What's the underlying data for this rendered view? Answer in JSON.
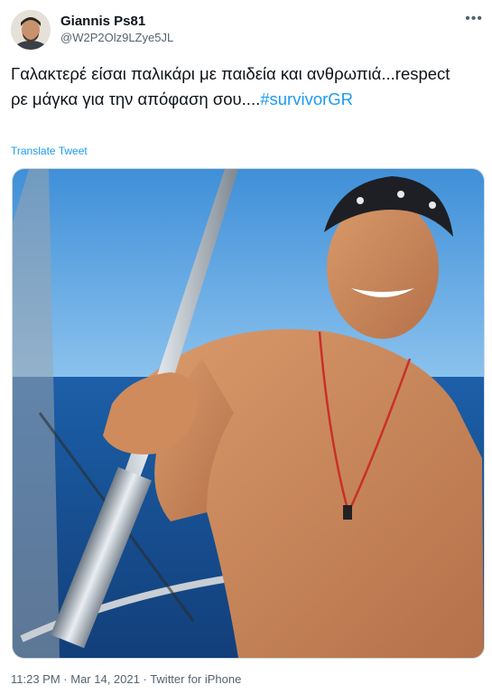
{
  "user": {
    "display_name": "Giannis Ps81",
    "handle": "@W2P2Olz9LZye5JL"
  },
  "tweet": {
    "text": "Γαλακτερέ είσαι παλικάρι με παιδεία και ανθρωπιά...respect ρε μάγκα για την απόφαση σου....",
    "hashtag": "#survivorGR",
    "translate_label": "Translate Tweet"
  },
  "meta": {
    "time": "11:23 PM",
    "date": "Mar 14, 2021",
    "source": "Twitter for iPhone",
    "separator": " · "
  },
  "icons": {
    "more": "more-horizontal-icon"
  },
  "colors": {
    "link": "#1d9bf0",
    "text": "#0f1419",
    "secondary": "#536471"
  }
}
